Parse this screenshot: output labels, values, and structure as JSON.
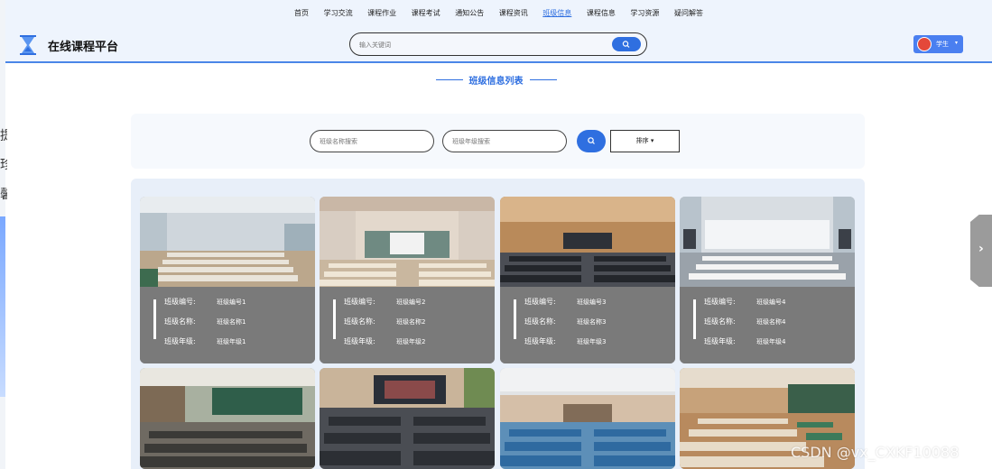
{
  "nav": {
    "items": [
      "首页",
      "学习交流",
      "课程作业",
      "课程考试",
      "通知公告",
      "课程资讯",
      "班级信息",
      "课程信息",
      "学习资源",
      "疑问解答"
    ],
    "active_index": 6
  },
  "header": {
    "brand": "在线课程平台",
    "search_placeholder": "输入关键词",
    "user_label": "学生",
    "user_caret": "▾"
  },
  "section": {
    "title": "班级信息列表"
  },
  "filter": {
    "name_placeholder": "班级名称搜索",
    "grade_placeholder": "班级年级搜索",
    "sort_label": "排序 ▾"
  },
  "card_labels": {
    "code": "班级编号:",
    "name": "班级名称:",
    "grade": "班级年级:"
  },
  "classes": [
    {
      "code": "班级编号1",
      "name": "班级名称1",
      "grade": "班级年级1"
    },
    {
      "code": "班级编号2",
      "name": "班级名称2",
      "grade": "班级年级2"
    },
    {
      "code": "班级编号3",
      "name": "班级名称3",
      "grade": "班级年级3"
    },
    {
      "code": "班级编号4",
      "name": "班级名称4",
      "grade": "班级年级4"
    }
  ],
  "left_glyphs": [
    "提",
    "珍",
    "馨"
  ],
  "side_handle": "›",
  "watermark": "CSDN @vx_CXKF10088",
  "colors": {
    "accent": "#2f6fe0",
    "header_bg": "#eef4fd",
    "card_info_bg": "#7a7a7a"
  }
}
